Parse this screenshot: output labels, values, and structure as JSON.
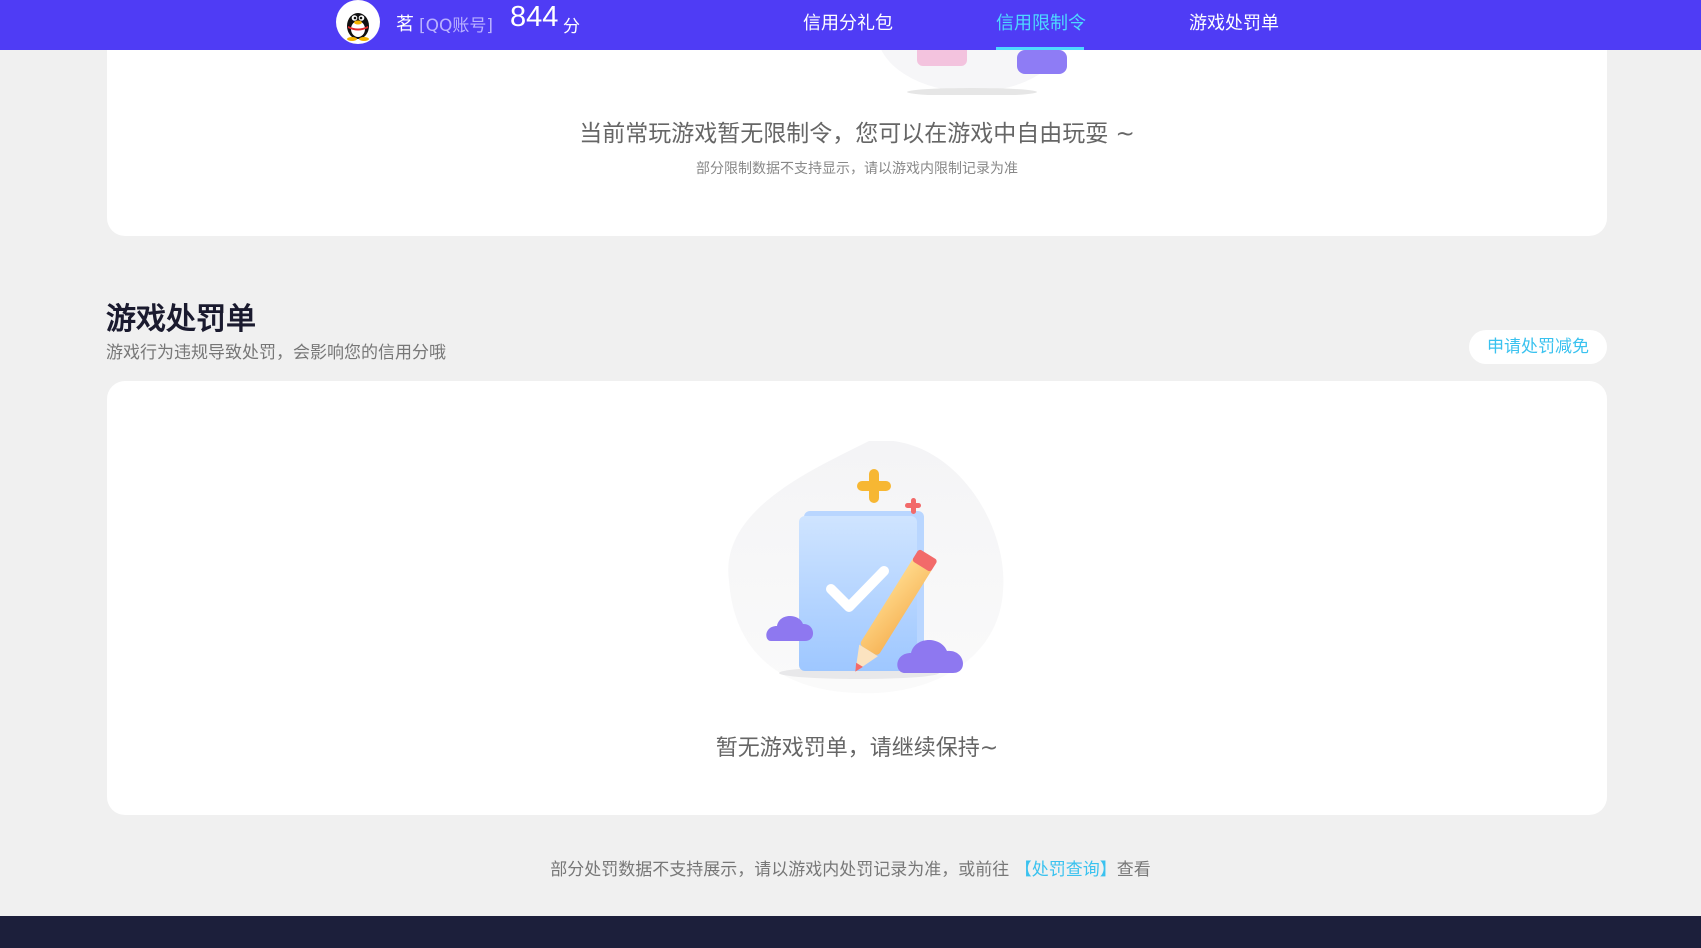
{
  "header": {
    "nickname": "茗",
    "account_tag": "[QQ账号]",
    "score": "844",
    "score_unit": "分",
    "tabs": [
      {
        "label": "信用分礼包",
        "active": false
      },
      {
        "label": "信用限制令",
        "active": true
      },
      {
        "label": "游戏处罚单",
        "active": false
      }
    ]
  },
  "restriction_card": {
    "empty_message": "当前常玩游戏暂无限制令，您可以在游戏中自由玩耍 ~",
    "note": "部分限制数据不支持显示，请以游戏内限制记录为准"
  },
  "penalty_section": {
    "title": "游戏处罚单",
    "description": "游戏行为违规导致处罚，会影响您的信用分哦",
    "apply_button": "申请处罚减免",
    "empty_message": "暂无游戏罚单，请继续保持~"
  },
  "footnote": {
    "prefix": "部分处罚数据不支持展示，请以游戏内处罚记录为准，或前往",
    "link": "【处罚查询】",
    "suffix": "查看"
  },
  "colors": {
    "header_bg": "#4f3cf5",
    "active_tab": "#4ed9ff",
    "link": "#3ac2ef",
    "footer_bg": "#1c1f3b",
    "page_bg": "#f0f0f0"
  },
  "icons": [
    "qq-penguin-avatar-icon",
    "empty-restriction-illustration",
    "empty-penalty-clipboard-pencil-illustration"
  ]
}
